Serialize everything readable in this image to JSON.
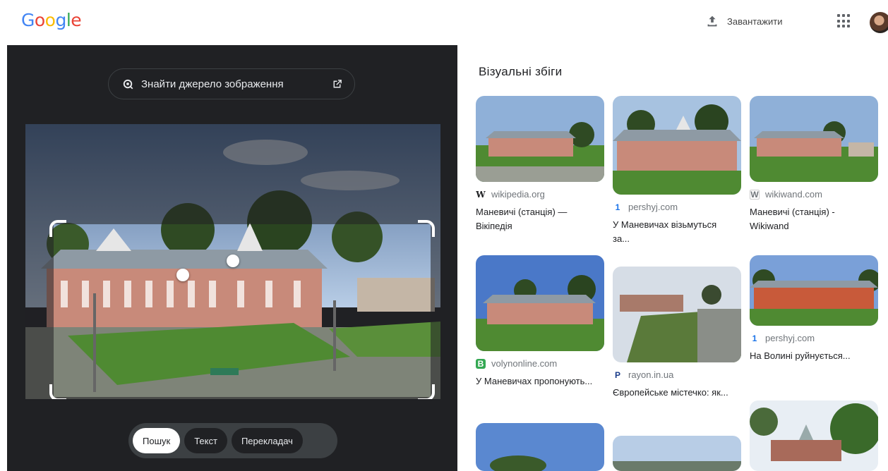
{
  "header": {
    "logo_text": "Google",
    "upload_label": "Завантажити"
  },
  "left_panel": {
    "find_source_label": "Знайти джерело зображення",
    "modes": [
      {
        "label": "Пошук",
        "active": true
      },
      {
        "label": "Текст",
        "active": false
      },
      {
        "label": "Перекладач",
        "active": false
      }
    ]
  },
  "results": {
    "title": "Візуальні збіги",
    "cards": [
      {
        "source": "wikipedia.org",
        "favicon": "W",
        "title": "Маневичі (станція) — Вікіпедія"
      },
      {
        "source": "pershyj.com",
        "favicon": "1",
        "title": "У Маневичах візьмуться за..."
      },
      {
        "source": "wikiwand.com",
        "favicon": "W",
        "title": "Маневичі (станція) - Wikiwand"
      },
      {
        "source": "volynonline.com",
        "favicon": "B",
        "title": "У Маневичах пропонують..."
      },
      {
        "source": "rayon.in.ua",
        "favicon": "P",
        "title": "Європейське містечко: як..."
      },
      {
        "source": "pershyj.com",
        "favicon": "1",
        "title": "На Волині руйнується..."
      }
    ]
  },
  "colors": {
    "google_blue": "#4285F4",
    "google_red": "#EA4335",
    "google_yellow": "#FBBC05",
    "google_green": "#34A853",
    "panel_bg": "#202124"
  }
}
